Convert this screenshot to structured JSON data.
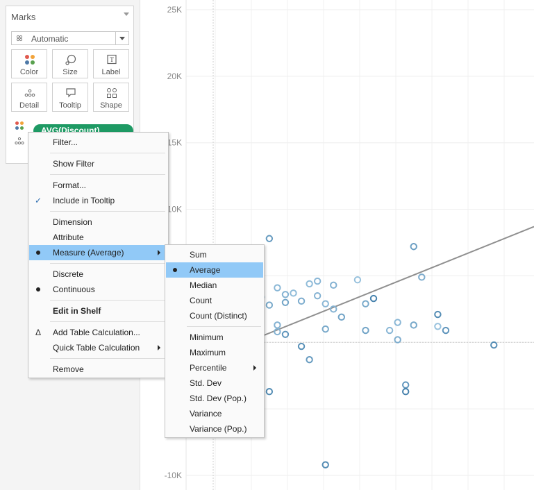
{
  "marks_card": {
    "title": "Marks",
    "mark_type": "Automatic",
    "buttons": [
      "Color",
      "Size",
      "Label",
      "Detail",
      "Tooltip",
      "Shape"
    ],
    "pill_label": "AVG(Discount)"
  },
  "context_menu": {
    "items": [
      {
        "label": "Filter...",
        "mark": "",
        "submenu": false,
        "bold": false
      },
      {
        "label": "Show Filter",
        "mark": "",
        "submenu": false,
        "bold": false
      },
      {
        "label": "Format...",
        "mark": "",
        "submenu": false,
        "bold": false
      },
      {
        "label": "Include in Tooltip",
        "mark": "check",
        "submenu": false,
        "bold": false
      },
      {
        "label": "Dimension",
        "mark": "",
        "submenu": false,
        "bold": false
      },
      {
        "label": "Attribute",
        "mark": "",
        "submenu": false,
        "bold": false
      },
      {
        "label": "Measure (Average)",
        "mark": "dot",
        "submenu": true,
        "bold": false,
        "highlighted": true
      },
      {
        "label": "Discrete",
        "mark": "",
        "submenu": false,
        "bold": false
      },
      {
        "label": "Continuous",
        "mark": "dot",
        "submenu": false,
        "bold": false
      },
      {
        "label": "Edit in Shelf",
        "mark": "",
        "submenu": false,
        "bold": true
      },
      {
        "label": "Add Table Calculation...",
        "mark": "delta",
        "submenu": false,
        "bold": false
      },
      {
        "label": "Quick Table Calculation",
        "mark": "",
        "submenu": true,
        "bold": false
      },
      {
        "label": "Remove",
        "mark": "",
        "submenu": false,
        "bold": false
      }
    ],
    "check_glyph": "✓",
    "delta_glyph": "Δ"
  },
  "measure_submenu": {
    "items": [
      {
        "label": "Sum",
        "mark": "",
        "submenu": false
      },
      {
        "label": "Average",
        "mark": "dot",
        "submenu": false,
        "highlighted": true
      },
      {
        "label": "Median",
        "mark": "",
        "submenu": false
      },
      {
        "label": "Count",
        "mark": "",
        "submenu": false
      },
      {
        "label": "Count (Distinct)",
        "mark": "",
        "submenu": false
      },
      {
        "label": "Minimum",
        "mark": "",
        "submenu": false
      },
      {
        "label": "Maximum",
        "mark": "",
        "submenu": false
      },
      {
        "label": "Percentile",
        "mark": "",
        "submenu": true
      },
      {
        "label": "Std. Dev",
        "mark": "",
        "submenu": false
      },
      {
        "label": "Std. Dev (Pop.)",
        "mark": "",
        "submenu": false
      },
      {
        "label": "Variance",
        "mark": "",
        "submenu": false
      },
      {
        "label": "Variance (Pop.)",
        "mark": "",
        "submenu": false
      }
    ]
  },
  "colors": {
    "pill": "#1e9a64",
    "menu_highlight": "#91c9f7",
    "trend_line": "#8f8f8f",
    "mark_dark": "#2e6f9e",
    "mark_light": "#a9cfe8"
  },
  "chart_data": {
    "type": "scatter",
    "y_ticks": [
      "25K",
      "20K",
      "15K",
      "10K",
      "-10K"
    ],
    "ylim": [
      -10000,
      25000
    ],
    "grid": true,
    "trend_line": true,
    "points": [
      {
        "x": 0.17,
        "y": 7800,
        "shade": 0.55
      },
      {
        "x": 0.35,
        "y": 7200,
        "shade": 0.5
      },
      {
        "x": 0.23,
        "y": 4600,
        "shade": 0.25
      },
      {
        "x": 0.25,
        "y": 4300,
        "shade": 0.3
      },
      {
        "x": 0.28,
        "y": 4700,
        "shade": 0.15
      },
      {
        "x": 0.36,
        "y": 4900,
        "shade": 0.35
      },
      {
        "x": 0.3,
        "y": 3300,
        "shade": 0.8
      },
      {
        "x": 0.38,
        "y": 2100,
        "shade": 0.7
      },
      {
        "x": 0.18,
        "y": 4100,
        "shade": 0.25
      },
      {
        "x": 0.19,
        "y": 3000,
        "shade": 0.45
      },
      {
        "x": 0.19,
        "y": 3600,
        "shade": 0.3
      },
      {
        "x": 0.2,
        "y": 3700,
        "shade": 0.2
      },
      {
        "x": 0.21,
        "y": 3100,
        "shade": 0.35
      },
      {
        "x": 0.22,
        "y": 4400,
        "shade": 0.2
      },
      {
        "x": 0.23,
        "y": 3500,
        "shade": 0.3
      },
      {
        "x": 0.24,
        "y": 2900,
        "shade": 0.25
      },
      {
        "x": 0.25,
        "y": 2500,
        "shade": 0.3
      },
      {
        "x": 0.16,
        "y": 3400,
        "shade": 0.35
      },
      {
        "x": 0.17,
        "y": 2800,
        "shade": 0.4
      },
      {
        "x": 0.15,
        "y": 2300,
        "shade": 0.4
      },
      {
        "x": 0.14,
        "y": 1600,
        "shade": 0.5
      },
      {
        "x": 0.18,
        "y": 1300,
        "shade": 0.3
      },
      {
        "x": 0.18,
        "y": 800,
        "shade": 0.3
      },
      {
        "x": 0.24,
        "y": 1000,
        "shade": 0.4
      },
      {
        "x": 0.29,
        "y": 900,
        "shade": 0.45
      },
      {
        "x": 0.32,
        "y": 900,
        "shade": 0.25
      },
      {
        "x": 0.33,
        "y": 200,
        "shade": 0.35
      },
      {
        "x": 0.35,
        "y": 1300,
        "shade": 0.4
      },
      {
        "x": 0.39,
        "y": 900,
        "shade": 0.6
      },
      {
        "x": 0.29,
        "y": 2900,
        "shade": 0.4
      },
      {
        "x": 0.26,
        "y": 1900,
        "shade": 0.45
      },
      {
        "x": 0.33,
        "y": 1500,
        "shade": 0.25
      },
      {
        "x": 0.38,
        "y": 1200,
        "shade": 0.15
      },
      {
        "x": 0.19,
        "y": 600,
        "shade": 0.6
      },
      {
        "x": 0.21,
        "y": -300,
        "shade": 0.65
      },
      {
        "x": 0.22,
        "y": -1300,
        "shade": 0.55
      },
      {
        "x": 0.17,
        "y": -3700,
        "shade": 0.7
      },
      {
        "x": 0.34,
        "y": -3200,
        "shade": 0.6
      },
      {
        "x": 0.24,
        "y": -9200,
        "shade": 0.7
      },
      {
        "x": 0.34,
        "y": -3700,
        "shade": 0.8
      },
      {
        "x": 0.45,
        "y": -200,
        "shade": 0.7
      }
    ]
  }
}
